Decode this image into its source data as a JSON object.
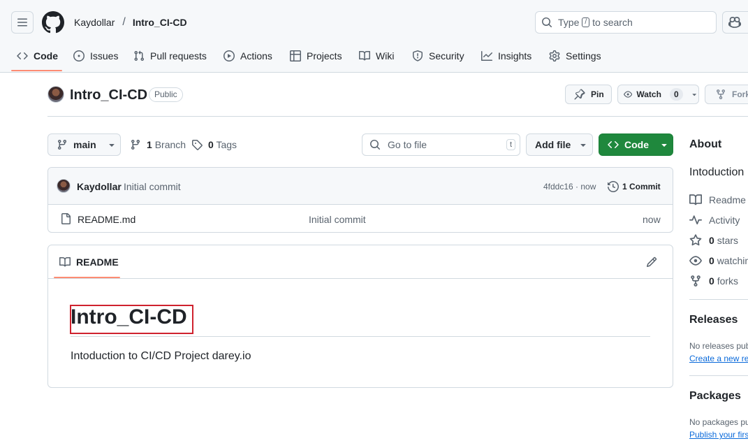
{
  "header": {
    "owner": "Kaydollar",
    "separator": "/",
    "repo": "Intro_CI-CD",
    "search_prefix": "Type",
    "search_key": "/",
    "search_suffix": "to search"
  },
  "tabs": [
    {
      "label": "Code",
      "icon": "code-icon",
      "active": true
    },
    {
      "label": "Issues",
      "icon": "issue-opened-icon"
    },
    {
      "label": "Pull requests",
      "icon": "git-pull-request-icon"
    },
    {
      "label": "Actions",
      "icon": "play-icon"
    },
    {
      "label": "Projects",
      "icon": "table-icon"
    },
    {
      "label": "Wiki",
      "icon": "book-icon"
    },
    {
      "label": "Security",
      "icon": "shield-icon"
    },
    {
      "label": "Insights",
      "icon": "graph-icon"
    },
    {
      "label": "Settings",
      "icon": "gear-icon"
    }
  ],
  "repo_header": {
    "title": "Intro_CI-CD",
    "visibility": "Public",
    "pin_label": "Pin",
    "watch_label": "Watch",
    "watch_count": "0",
    "fork_label": "Fork"
  },
  "toolbar": {
    "branch": "main",
    "branch_count": "1",
    "branch_label": "Branch",
    "tag_count": "0",
    "tag_label": "Tags",
    "go_to_file_placeholder": "Go to file",
    "go_to_file_key": "t",
    "add_file_label": "Add file",
    "code_label": "Code"
  },
  "commit": {
    "author": "Kaydollar",
    "message": "Initial commit",
    "sha_time": "4fddc16 · now",
    "commit_count_label": "1 Commit"
  },
  "files": [
    {
      "name": "README.md",
      "message": "Initial commit",
      "time": "now"
    }
  ],
  "readme": {
    "tab_label": "README",
    "heading": "Intro_CI-CD",
    "body": "Intoduction to CI/CD Project darey.io"
  },
  "about": {
    "title": "About",
    "description": "Intoduction",
    "readme_label": "Readme",
    "activity_label": "Activity",
    "stars_count": "0",
    "stars_label": "stars",
    "watching_count": "0",
    "watching_label": "watchin",
    "forks_count": "0",
    "forks_label": "forks"
  },
  "releases": {
    "title": "Releases",
    "note": "No releases pub",
    "link": "Create a new re"
  },
  "packages": {
    "title": "Packages",
    "note": "No packages pu",
    "link": "Publish your firs"
  },
  "colors": {
    "accent_green": "#1f883d",
    "active_tab_underline": "#fd8c73",
    "link_blue": "#0969da",
    "highlight_box": "#cf222e"
  }
}
